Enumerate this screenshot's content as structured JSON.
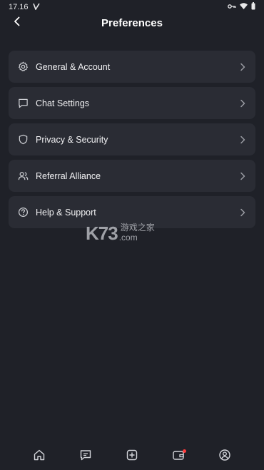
{
  "status_bar": {
    "time": "17.16",
    "icons": [
      "check-icon",
      "key-icon",
      "wifi-icon",
      "battery-icon"
    ]
  },
  "header": {
    "title": "Preferences",
    "back_icon": "back-arrow-icon"
  },
  "menu": {
    "items": [
      {
        "label": "General & Account",
        "icon": "gear-icon"
      },
      {
        "label": "Chat Settings",
        "icon": "chat-icon"
      },
      {
        "label": "Privacy & Security",
        "icon": "shield-icon"
      },
      {
        "label": "Referral Alliance",
        "icon": "users-icon"
      },
      {
        "label": "Help & Support",
        "icon": "help-icon"
      }
    ]
  },
  "watermark": {
    "brand": "K73",
    "cn": "游戏之家",
    "domain": ".com"
  },
  "bottom_nav": {
    "items": [
      {
        "icon": "home-icon"
      },
      {
        "icon": "chat-icon"
      },
      {
        "icon": "add-icon"
      },
      {
        "icon": "wallet-icon",
        "badge": true
      },
      {
        "icon": "profile-icon"
      }
    ]
  },
  "colors": {
    "background": "#1f2128",
    "card": "#2a2c34",
    "badge": "#ff3b3b"
  }
}
